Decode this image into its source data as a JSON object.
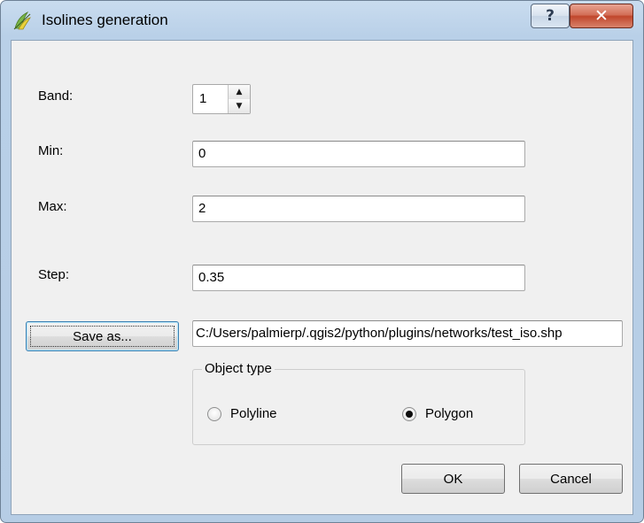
{
  "window": {
    "title": "Isolines generation",
    "help_button": "?",
    "close_button": "✕"
  },
  "form": {
    "band": {
      "label": "Band:",
      "value": "1"
    },
    "min": {
      "label": "Min:",
      "value": "0"
    },
    "max": {
      "label": "Max:",
      "value": "2"
    },
    "step": {
      "label": "Step:",
      "value": "0.35"
    },
    "save_as": {
      "button_label": "Save as...",
      "path": "C:/Users/palmierp/.qgis2/python/plugins/networks/test_iso.shp"
    },
    "object_type": {
      "title": "Object type",
      "options": [
        {
          "label": "Polyline",
          "selected": false
        },
        {
          "label": "Polygon",
          "selected": true
        }
      ]
    }
  },
  "buttons": {
    "ok": "OK",
    "cancel": "Cancel"
  },
  "icons": {
    "app": "qgis-icon",
    "spin_up": "arrow-up-icon",
    "spin_down": "arrow-down-icon"
  },
  "colors": {
    "frame": "#b9d0e8",
    "client": "#f0f0f0",
    "close": "#c0462c",
    "qgis_green": "#7ab648"
  }
}
